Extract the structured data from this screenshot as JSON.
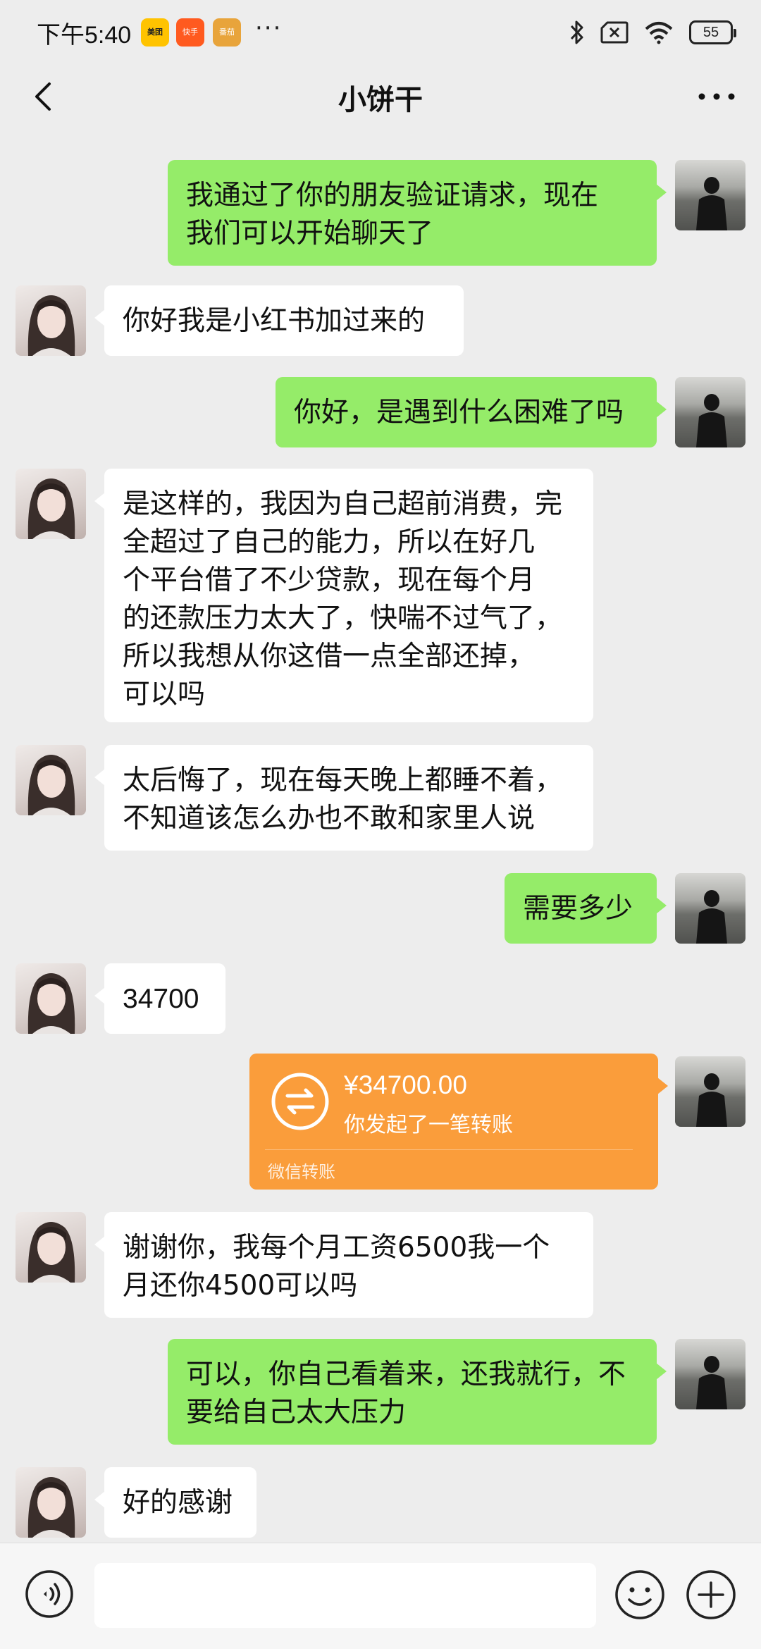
{
  "status_bar": {
    "time": "下午5:40",
    "app_badges": [
      "美团",
      "快手",
      "番茄"
    ],
    "more_dots": "···",
    "battery": "55"
  },
  "header": {
    "title": "小饼干",
    "back_icon": "chevron-left-icon",
    "more_icon": "more-dots-icon"
  },
  "messages": [
    {
      "sender": "me",
      "text": "我通过了你的朋友验证请求，现在\n我们可以开始聊天了"
    },
    {
      "sender": "her",
      "text": "你好我是小红书加过来的"
    },
    {
      "sender": "me",
      "text": "你好，是遇到什么困难了吗"
    },
    {
      "sender": "her",
      "text": "是这样的，我因为自己超前消费，完\n全超过了自己的能力，所以在好几\n个平台借了不少贷款，现在每个月\n的还款压力太大了，快喘不过气了，\n所以我想从你这借一点全部还掉，\n可以吗"
    },
    {
      "sender": "her",
      "text": "太后悔了，现在每天晚上都睡不着，\n不知道该怎么办也不敢和家里人说"
    },
    {
      "sender": "me",
      "text": "需要多少"
    },
    {
      "sender": "her",
      "text": "34700"
    },
    {
      "sender": "her",
      "text": "谢谢你，我每个月工资6500我一个\n月还你4500可以吗"
    },
    {
      "sender": "me",
      "text": "可以，你自己看着来，还我就行，不\n要给自己太大压力"
    },
    {
      "sender": "her",
      "text": "好的感谢"
    }
  ],
  "transfer": {
    "amount": "¥34700.00",
    "description": "你发起了一笔转账",
    "footer": "微信转账",
    "icon": "transfer-arrows-icon"
  },
  "input_bar": {
    "voice_icon": "voice-icon",
    "emoji_icon": "emoji-icon",
    "plus_icon": "plus-icon",
    "placeholder": ""
  },
  "colors": {
    "background": "#ededed",
    "my_bubble": "#95ec69",
    "her_bubble": "#ffffff",
    "transfer_card": "#fa9d3b"
  }
}
